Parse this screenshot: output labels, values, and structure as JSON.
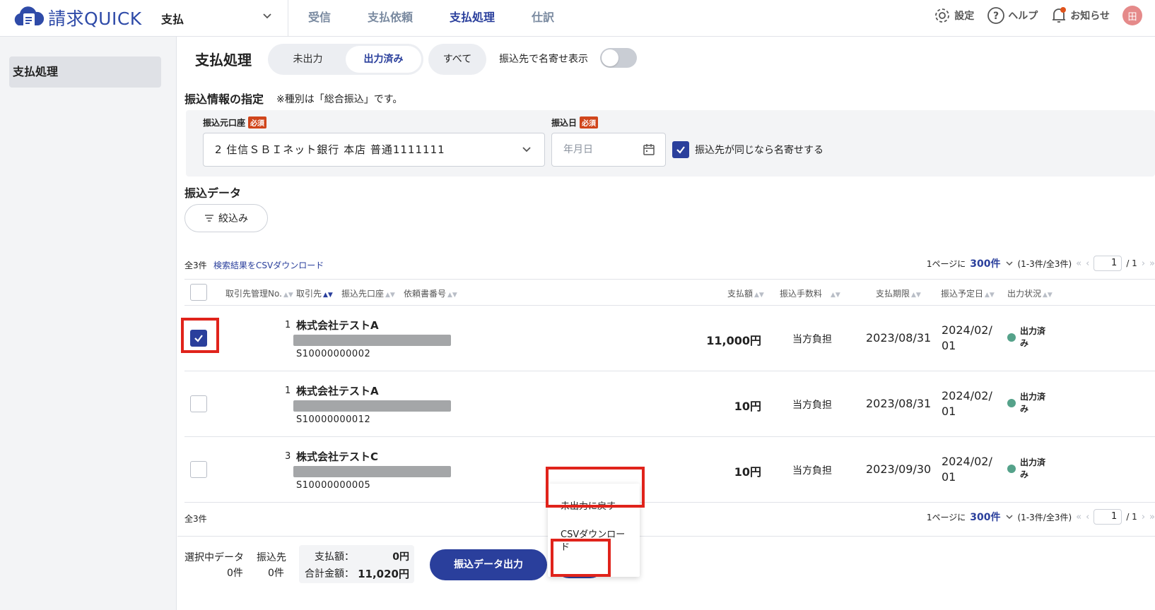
{
  "header": {
    "logo_text": "請求QUICK",
    "app_select": "支払",
    "nav": [
      {
        "label": "受信"
      },
      {
        "label": "支払依頼"
      },
      {
        "label": "支払処理"
      },
      {
        "label": "仕訳"
      }
    ],
    "settings": "設定",
    "help": "ヘルプ",
    "notice": "お知らせ",
    "avatar": "田"
  },
  "sidebar": {
    "items": [
      {
        "label": "支払処理"
      }
    ]
  },
  "main": {
    "title": "支払処理",
    "tabs": [
      "未出力",
      "出力済み",
      "すべて"
    ],
    "toggle_label": "振込先で名寄せ表示",
    "transfer_section": "振込情報の指定",
    "transfer_note": "※種別は「総合振込」です。",
    "account_label": "振込元口座",
    "required": "必須",
    "account_value": "2 住信ＳＢＩネット銀行 本店 普通1111111",
    "date_label": "振込日",
    "date_placeholder": "年月日",
    "group_check": "振込先が同じなら名寄せする",
    "data_section": "振込データ",
    "filter_btn": "絞込み"
  },
  "table": {
    "total": "全3件",
    "csv_link": "検索結果をCSVダウンロード",
    "per_page_prefix": "1ページに",
    "per_page": "300件",
    "range": "(1-3件/全3件)",
    "page": "1",
    "page_total": "/ 1",
    "columns": {
      "mgmt_no": "取引先管理No.",
      "partner": "取引先",
      "account": "振込先口座",
      "request_no": "依頼書番号",
      "amount": "支払額",
      "fee": "振込手数料",
      "due": "支払期限",
      "scheduled": "振込予定日",
      "status": "出力状況"
    },
    "rows": [
      {
        "idx": "1",
        "name": "株式会社テストA",
        "doc": "S10000000002",
        "amount": "11,000円",
        "fee": "当方負担",
        "due": "2023/08/31",
        "sched": "2024/02/01",
        "status": "出力済み",
        "checked": true
      },
      {
        "idx": "1",
        "name": "株式会社テストA",
        "doc": "S10000000012",
        "amount": "10円",
        "fee": "当方負担",
        "due": "2023/08/31",
        "sched": "2024/02/01",
        "status": "出力済み",
        "checked": false
      },
      {
        "idx": "3",
        "name": "株式会社テストC",
        "doc": "S10000000005",
        "amount": "10円",
        "fee": "当方負担",
        "due": "2023/09/30",
        "sched": "2024/02/01",
        "status": "出力済み",
        "checked": false
      }
    ]
  },
  "footer": {
    "selected_label": "選択中データ",
    "selected_count": "0件",
    "payee_label": "振込先",
    "payee_count": "0件",
    "amount_label": "支払額：",
    "amount_value": "0円",
    "total_label": "合計金額：",
    "total_value": "11,020円",
    "export_btn": "振込データ出力",
    "more_btn": "…"
  },
  "dropdown": {
    "items": [
      "未出力に戻す",
      "CSVダウンロード"
    ]
  },
  "colors": {
    "accent": "#2a3f9c",
    "highlight": "#e0231b",
    "status_ok": "#55a28a"
  }
}
